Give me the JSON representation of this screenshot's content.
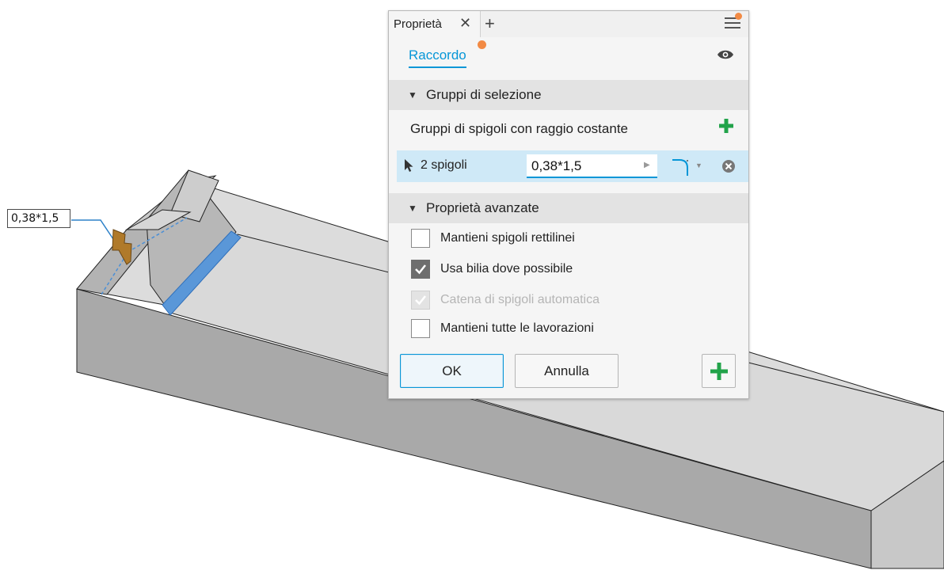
{
  "viewport": {
    "dimension_value": "0,38*1,5"
  },
  "panel": {
    "tab_label": "Proprietà",
    "tab_close": "✕",
    "tab_add": "+",
    "feature_tab": "Raccordo",
    "sections": {
      "selection_groups": "Gruppi di selezione",
      "advanced": "Proprietà avanzate"
    },
    "edge_group_title": "Gruppi di spigoli con raggio costante",
    "selection_row": {
      "label": "2 spigoli",
      "value": "0,38*1,5"
    },
    "options": [
      {
        "label": "Mantieni spigoli rettilinei",
        "checked": false,
        "enabled": true
      },
      {
        "label": "Usa bilia dove possibile",
        "checked": true,
        "enabled": true
      },
      {
        "label": "Catena di spigoli automatica",
        "checked": true,
        "enabled": false
      },
      {
        "label": "Mantieni tutte le lavorazioni",
        "checked": false,
        "enabled": true
      }
    ],
    "buttons": {
      "ok": "OK",
      "cancel": "Annulla"
    },
    "colors": {
      "accent": "#0696d7",
      "notification": "#f28a44",
      "add_green": "#22a34a",
      "selection_highlight": "#cfe9f7"
    }
  }
}
